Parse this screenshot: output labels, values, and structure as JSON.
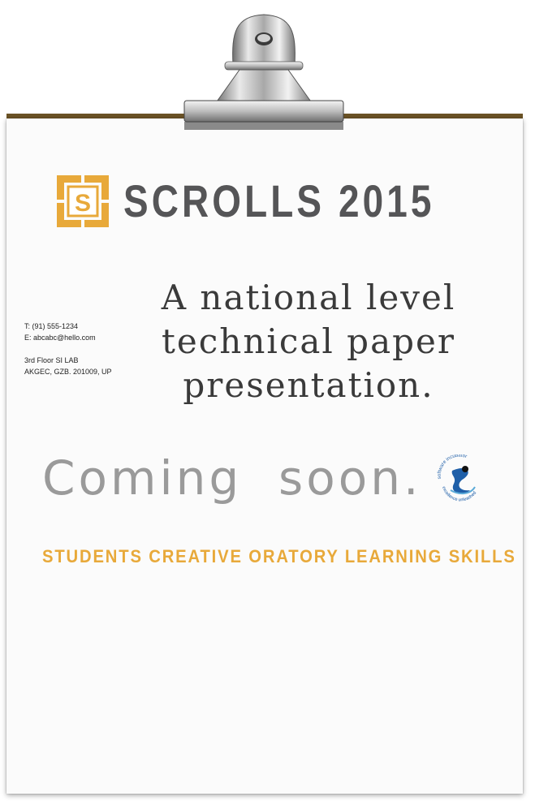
{
  "event": {
    "title": "SCROLLS 2015",
    "logo_letter": "S",
    "tagline_lines": [
      "A national level",
      "technical paper",
      "presentation."
    ],
    "status": "Coming  soon.",
    "acronym_expansion": "STUDENTS CREATIVE ORATORY LEARNING SKILLS"
  },
  "contact": {
    "phone": "T:  (91) 555-1234",
    "email": "E:  abcabc@hello.com",
    "address_line1": "3rd Floor SI  LAB",
    "address_line2": "AKGEC, GZB. 201009, UP"
  },
  "partner_logo": {
    "text_top": "software incubator",
    "text_bottom": "excellence unleashed",
    "icon": "si-swoosh-logo"
  },
  "colors": {
    "accent": "#e8a93a",
    "title": "#555557",
    "board": "#6b5326",
    "muted": "#9a9a9a"
  }
}
